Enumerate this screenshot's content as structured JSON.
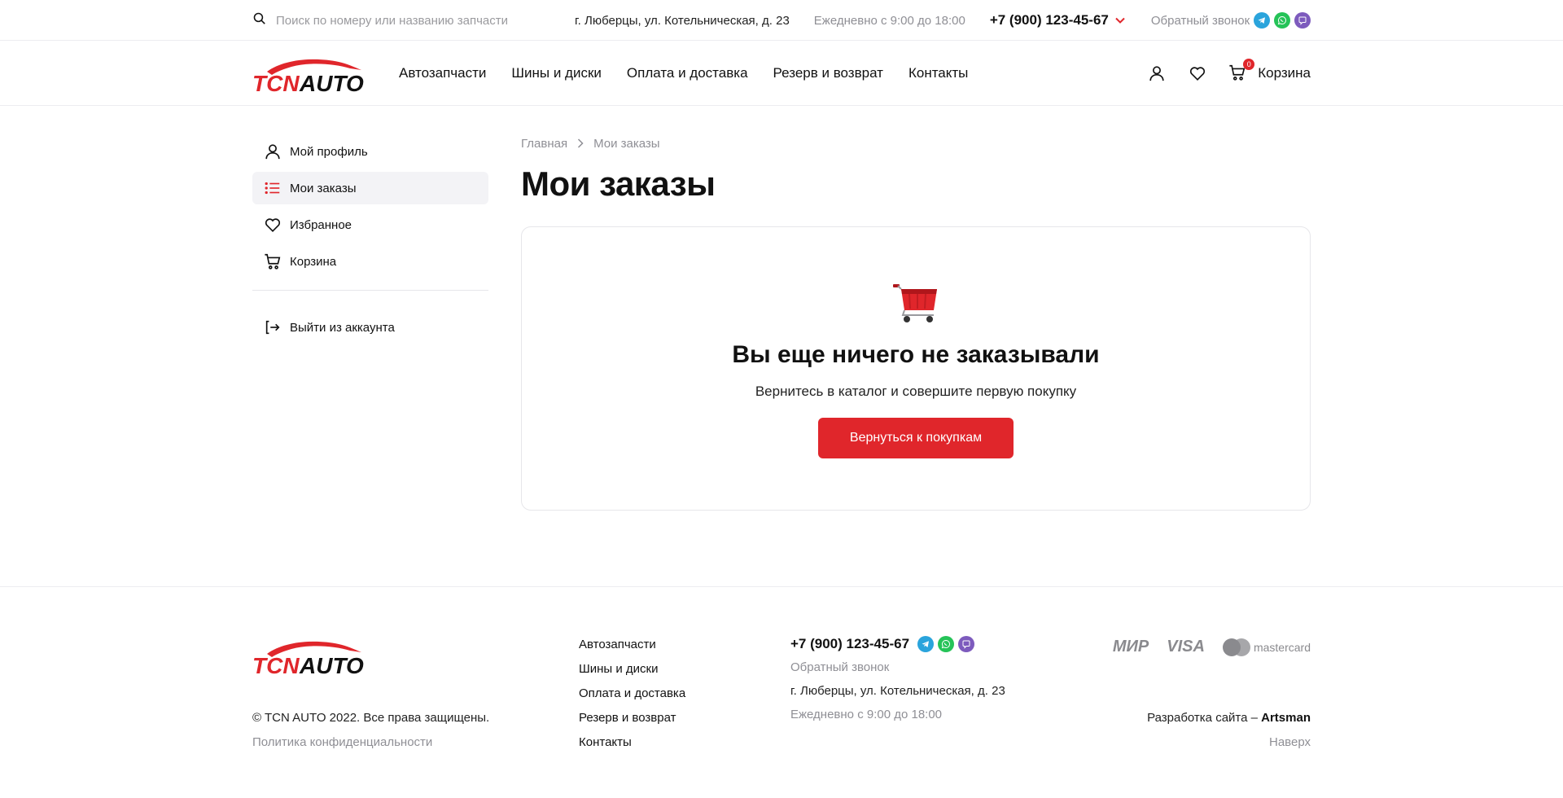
{
  "topbar": {
    "search_placeholder": "Поиск по номеру или названию запчасти",
    "address": "г. Люберцы, ул. Котельническая, д. 23",
    "hours": "Ежедневно с 9:00 до 18:00",
    "phone": "+7 (900) 123-45-67",
    "callback": "Обратный звонок",
    "messengers": [
      "telegram-icon",
      "whatsapp-icon",
      "viber-icon"
    ]
  },
  "header": {
    "logo_left": "TCN",
    "logo_right": "AUTO",
    "nav": [
      "Автозапчасти",
      "Шины и диски",
      "Оплата и доставка",
      "Резерв и возврат",
      "Контакты"
    ],
    "cart_label": "Корзина",
    "cart_count": "0"
  },
  "sidebar": {
    "items": [
      {
        "label": "Мой профиль",
        "icon": "user-icon",
        "active": false
      },
      {
        "label": "Мои заказы",
        "icon": "list-icon",
        "active": true
      },
      {
        "label": "Избранное",
        "icon": "heart-icon",
        "active": false
      },
      {
        "label": "Корзина",
        "icon": "cart-icon",
        "active": false
      }
    ],
    "logout": "Выйти из аккаунта"
  },
  "breadcrumb": {
    "home": "Главная",
    "current": "Мои заказы"
  },
  "page": {
    "title": "Мои заказы"
  },
  "empty_state": {
    "title": "Вы еще ничего не заказывали",
    "subtitle": "Вернитесь в каталог и совершите первую покупку",
    "button": "Вернуться к покупкам"
  },
  "footer": {
    "copyright": "© TCN AUTO 2022. Все права защищены.",
    "policy": "Политика конфиденциальности",
    "links": [
      "Автозапчасти",
      "Шины и диски",
      "Оплата и доставка",
      "Резерв и возврат",
      "Контакты"
    ],
    "phone": "+7 (900) 123-45-67",
    "callback": "Обратный звонок",
    "address": "г. Люберцы, ул. Котельническая, д. 23",
    "hours": "Ежедневно с 9:00 до 18:00",
    "payments": [
      "МИР",
      "VISA",
      "mastercard"
    ],
    "dev_prefix": "Разработка сайта – ",
    "dev_name": "Artsman",
    "up": "Наверх"
  },
  "colors": {
    "accent": "#e0262b",
    "muted": "#8f8f95",
    "border": "#e6e6ea",
    "active_bg": "#f3f3f6"
  }
}
